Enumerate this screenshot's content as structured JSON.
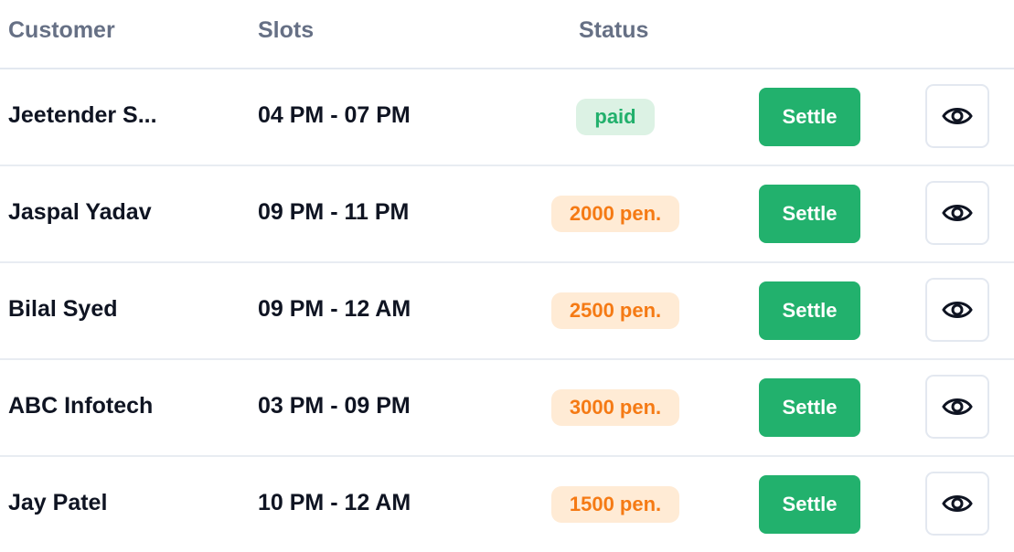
{
  "table": {
    "headers": {
      "customer": "Customer",
      "slots": "Slots",
      "status": "Status"
    },
    "rows": [
      {
        "customer": "Jeetender S...",
        "slot": "04 PM - 07 PM",
        "status": "paid",
        "status_type": "paid",
        "action_label": "Settle",
        "view_icon": "eye-icon"
      },
      {
        "customer": "Jaspal Yadav",
        "slot": "09 PM - 11 PM",
        "status": "2000 pen.",
        "status_type": "pending",
        "action_label": "Settle",
        "view_icon": "eye-icon"
      },
      {
        "customer": "Bilal Syed",
        "slot": "09 PM - 12 AM",
        "status": "2500 pen.",
        "status_type": "pending",
        "action_label": "Settle",
        "view_icon": "eye-icon"
      },
      {
        "customer": "ABC Infotech",
        "slot": "03 PM - 09 PM",
        "status": "3000 pen.",
        "status_type": "pending",
        "action_label": "Settle",
        "view_icon": "eye-icon"
      },
      {
        "customer": "Jay Patel",
        "slot": "10 PM - 12 AM",
        "status": "1500 pen.",
        "status_type": "pending",
        "action_label": "Settle",
        "view_icon": "eye-icon"
      }
    ]
  },
  "colors": {
    "header_text": "#667085",
    "body_text": "#0f1422",
    "settle_button": "#22b16d",
    "paid_badge_bg": "#dcf2e4",
    "paid_badge_text": "#22b06c",
    "pending_badge_bg": "#ffebd5",
    "pending_badge_text": "#f57a14",
    "divider": "#e3e8f0"
  }
}
